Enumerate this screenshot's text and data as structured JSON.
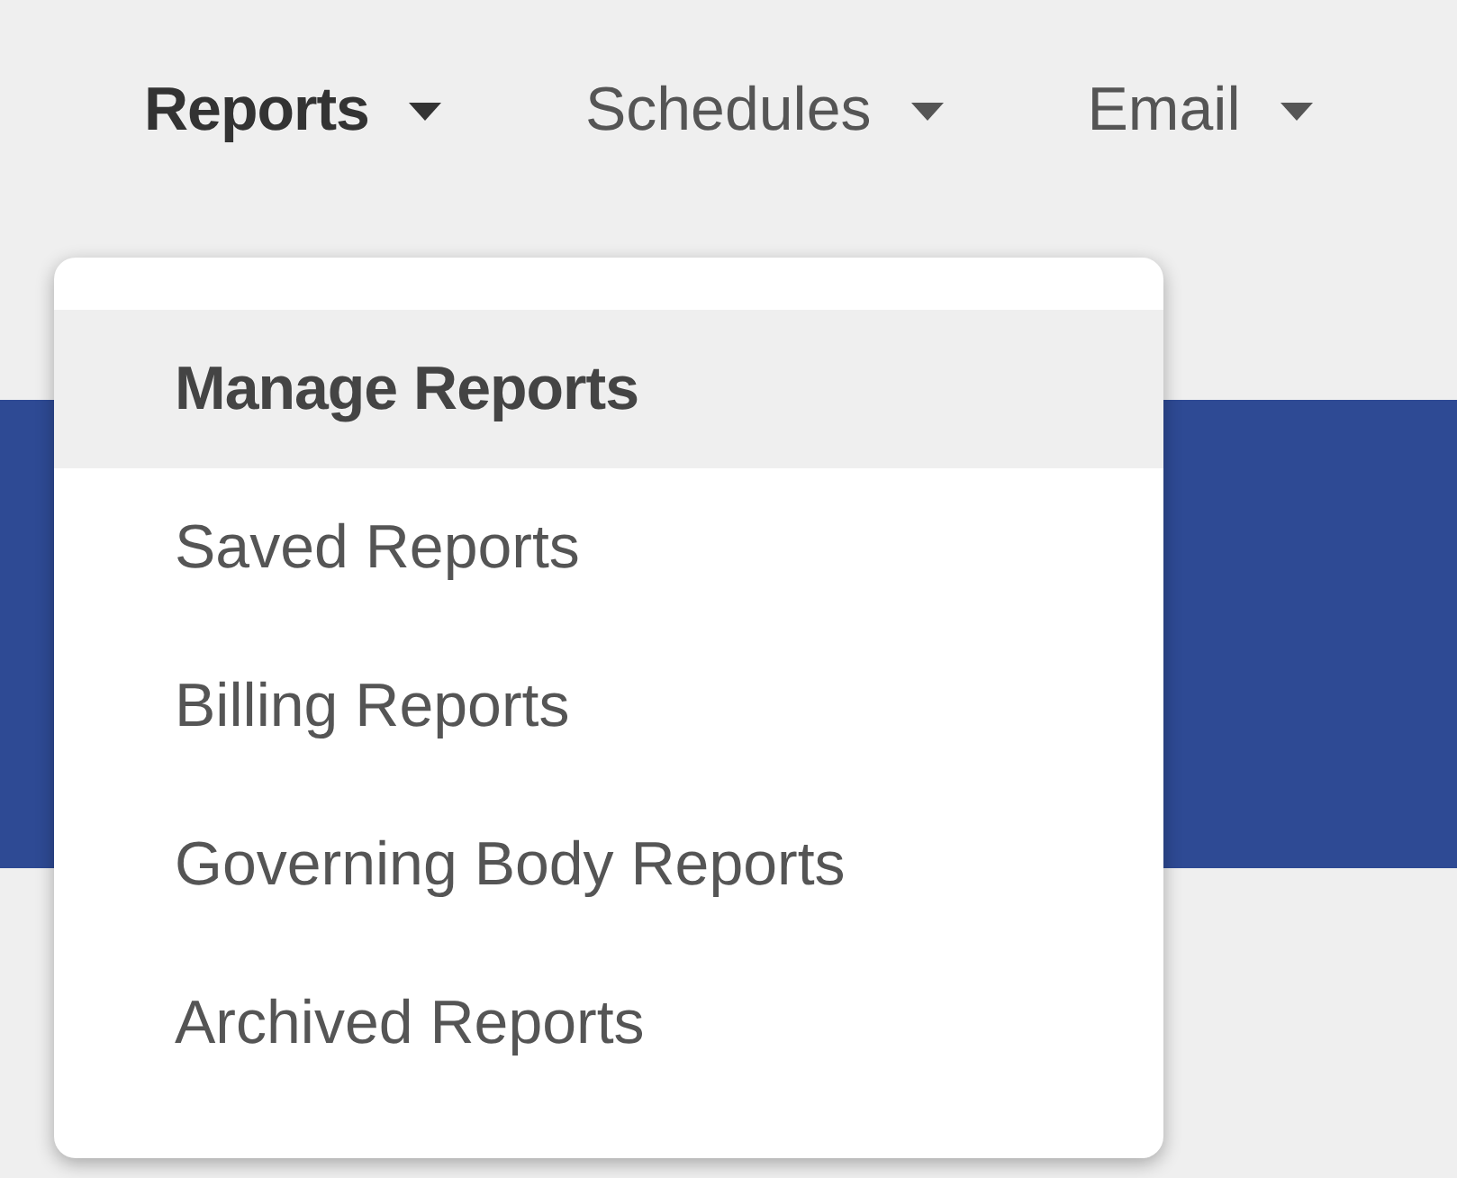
{
  "nav": [
    {
      "label": "Reports",
      "selected": true
    },
    {
      "label": "Schedules",
      "selected": false
    },
    {
      "label": "Email",
      "selected": false
    }
  ],
  "menu": {
    "items": [
      {
        "label": "Manage Reports",
        "selected": true
      },
      {
        "label": "Saved Reports",
        "selected": false
      },
      {
        "label": "Billing Reports",
        "selected": false
      },
      {
        "label": "Governing Body Reports",
        "selected": false
      },
      {
        "label": "Archived Reports",
        "selected": false
      }
    ]
  }
}
